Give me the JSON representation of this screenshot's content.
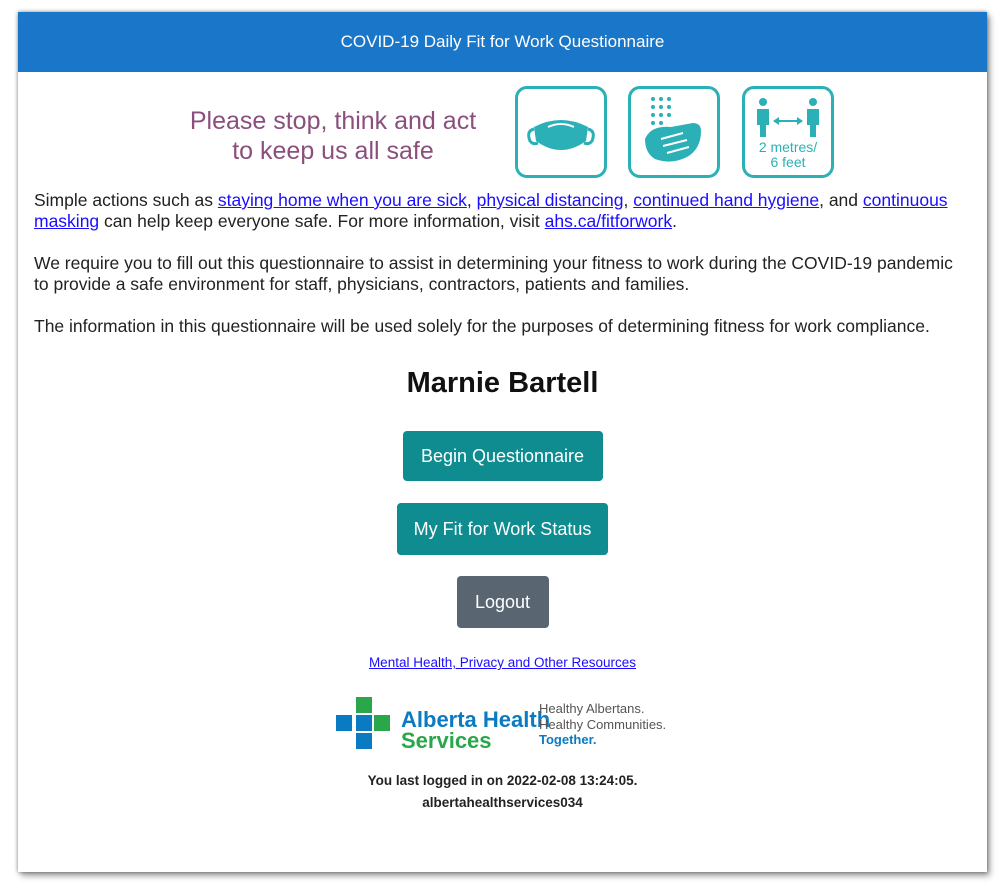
{
  "header": {
    "title": "COVID-19 Daily Fit for Work Questionnaire"
  },
  "banner": {
    "line1": "Please stop, think and act",
    "line2": "to keep us all safe",
    "icons": [
      "mask-icon",
      "hand-hygiene-icon",
      "physical-distance-icon"
    ],
    "distance_label_1": "2 metres/",
    "distance_label_2": "6 feet"
  },
  "intro": {
    "p1_before": "Simple actions such as ",
    "link_sick": "staying home when you are sick",
    "comma1": ", ",
    "link_distancing": "physical distancing",
    "comma2": ", ",
    "link_hygiene": "continued hand hygiene",
    "and": ", and",
    "link_masking": "continuous masking",
    "p1_middle": " can help keep everyone safe. For more information, visit ",
    "link_ahs": "ahs.ca/fitforwork",
    "period": ".",
    "p2": "We require you to fill out this questionnaire to assist in determining your fitness to work during the COVID-19 pandemic to provide a safe environment for staff, physicians, contractors, patients and families.",
    "p3": "The information in this questionnaire will be used solely for the purposes of determining fitness for work compliance."
  },
  "user": {
    "name": "Marnie Bartell"
  },
  "buttons": {
    "begin": "Begin Questionnaire",
    "status": "My Fit for Work Status",
    "logout": "Logout"
  },
  "resources_link": "Mental Health, Privacy and Other Resources",
  "logo": {
    "name_line1": "Alberta Health",
    "name_line2": "Services",
    "tag_line1": "Healthy Albertans.",
    "tag_line2": "Healthy Communities.",
    "tag_line3": "Together."
  },
  "footer": {
    "last_login": "You last logged in on 2022-02-08 13:24:05.",
    "username": "albertahealthservices034"
  },
  "colors": {
    "header": "#1976c8",
    "primary_button": "#0f8c90",
    "secondary_button": "#596571",
    "icon_teal": "#2ab0b6",
    "banner_text": "#8a4f7d",
    "link": "#1a0dff"
  }
}
